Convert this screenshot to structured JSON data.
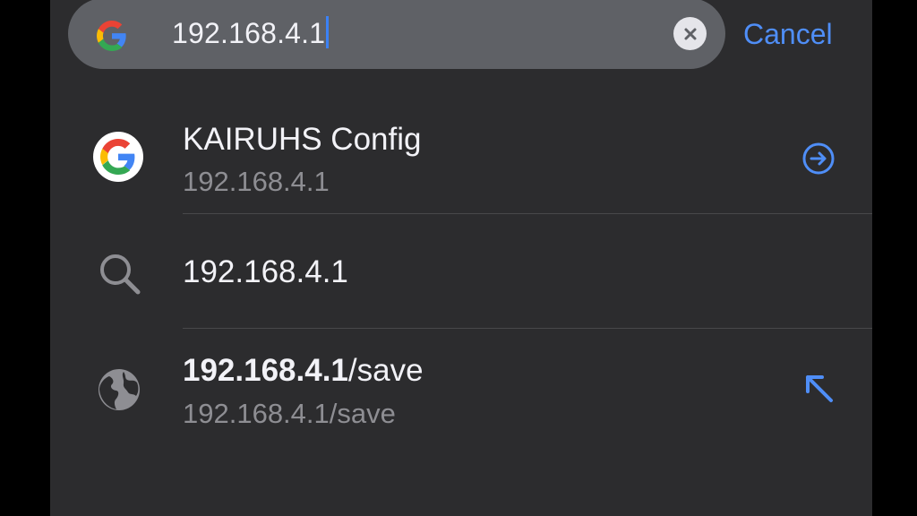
{
  "search": {
    "query": "192.168.4.1",
    "cancel_label": "Cancel"
  },
  "suggestions": [
    {
      "title": "KAIRUHS Config",
      "subtitle": "192.168.4.1",
      "icon": "google-icon",
      "action_icon": "arrow-circle-right-icon"
    },
    {
      "title": "192.168.4.1",
      "icon": "search-icon"
    },
    {
      "title_bold": "192.168.4.1",
      "title_rest": "/save",
      "subtitle_main": "192.168.4.1",
      "subtitle_rest": "/save",
      "icon": "globe-icon",
      "action_icon": "arrow-up-left-icon"
    }
  ],
  "colors": {
    "background": "#2c2c2e",
    "search_bar": "#5f6166",
    "accent": "#4f8ef7",
    "secondary_text": "#8e8e93"
  }
}
